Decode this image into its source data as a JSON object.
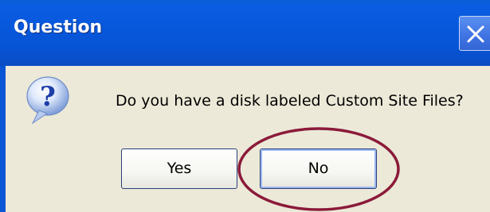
{
  "dialog": {
    "title": "Question",
    "message": "Do you have a disk labeled Custom Site Files?",
    "buttons": {
      "yes_label": "Yes",
      "no_label": "No"
    },
    "icon": "question-icon",
    "close_icon": "close-icon"
  },
  "colors": {
    "titlebar": "#0858dc",
    "body": "#ece9d8",
    "highlight_ellipse": "#8b1a3a"
  }
}
